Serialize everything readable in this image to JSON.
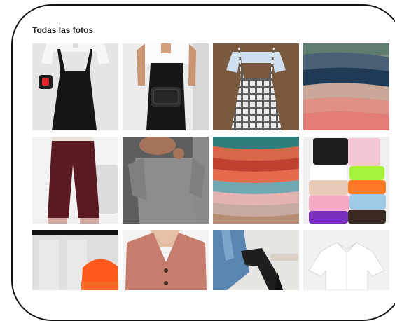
{
  "section": {
    "title": "Todas las fotos"
  },
  "photos": [
    {
      "name": "photo-black-overall-dress"
    },
    {
      "name": "photo-black-jumpsuit-belt-bag"
    },
    {
      "name": "photo-plaid-pinafore-dress"
    },
    {
      "name": "photo-folded-knit-sweaters"
    },
    {
      "name": "photo-burgundy-knit-pants"
    },
    {
      "name": "photo-grey-knit-dress"
    },
    {
      "name": "photo-stacked-colorful-sweaters"
    },
    {
      "name": "photo-colorful-beanies"
    },
    {
      "name": "photo-orange-beanie"
    },
    {
      "name": "photo-pink-cardigan"
    },
    {
      "name": "photo-denim-jacket"
    },
    {
      "name": "photo-white-shirt"
    }
  ],
  "colors": {
    "frame_border": "#111111",
    "title_text": "#1c1e21",
    "badge_bg": "#1c1c1c",
    "badge_icon": "#e0262a"
  }
}
